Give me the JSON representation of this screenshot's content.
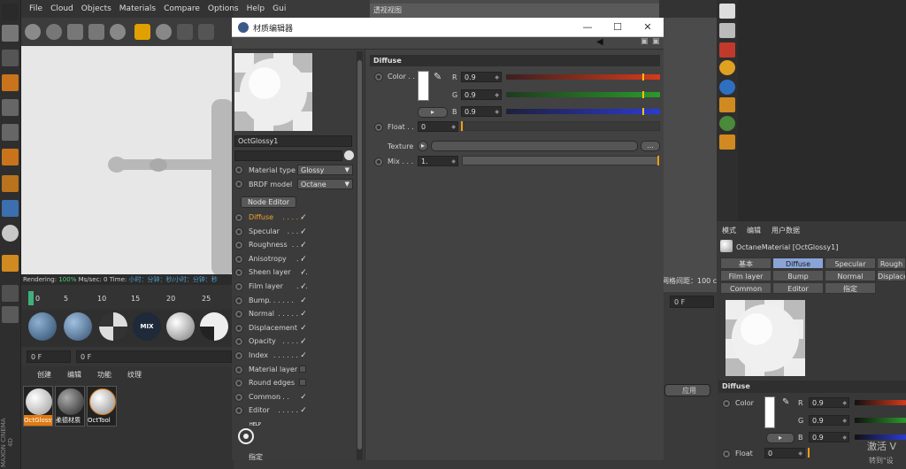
{
  "menubar": {
    "items": [
      "File",
      "Cloud",
      "Objects",
      "Materials",
      "Compare",
      "Options",
      "Help",
      "Gui"
    ]
  },
  "viewport": {
    "status_rendering_label": "Rendering:",
    "status_rendering_value": "100%",
    "status_ms_label": "Ms/sec:",
    "status_ms_value": "0",
    "status_time_label": "Time:",
    "status_time_value": "小时：分钟：秒/小时：分钟：秒"
  },
  "timeline": {
    "ticks": [
      "0",
      "5",
      "10",
      "15",
      "20",
      "25"
    ],
    "frame_field": "0 F",
    "frame_field2": "0 F"
  },
  "swatches": {
    "mix_label": "MIX"
  },
  "material_manager": {
    "menu": [
      "创建",
      "编辑",
      "功能",
      "纹理"
    ],
    "materials": [
      {
        "name": "OctGlossy",
        "selected": true
      },
      {
        "name": "柔德材质",
        "selected": false
      },
      {
        "name": "OctTool",
        "selected": false
      }
    ]
  },
  "bg_viewport": {
    "header": "透视视图",
    "grid_info": "网格间距：100 cm"
  },
  "attr_manager": {
    "menu": [
      "模式",
      "编辑",
      "用户数据"
    ],
    "title": "OctaneMaterial [OctGlossy1]",
    "tabs_row1": [
      "基本",
      "Diffuse",
      "Specular",
      "Rough"
    ],
    "tabs_row2": [
      "Film layer",
      "Bump",
      "Normal",
      "Displace"
    ],
    "tabs_row3": [
      "Common",
      "Editor",
      "指定"
    ],
    "active_tab": "Diffuse",
    "section": "Diffuse",
    "color_label": "Color",
    "r_label": "R",
    "g_label": "G",
    "b_label": "B",
    "r_value": "0.9",
    "g_value": "0.9",
    "b_value": "0.9",
    "float_label": "Float",
    "float_value": "0",
    "frame_field": "0 F",
    "apply_button": "应用"
  },
  "dialog": {
    "title": "材质编辑器",
    "material_name": "OctGlossy1",
    "material_type_label": "Material type",
    "material_type_value": "Glossy",
    "brdf_label": "BRDF model",
    "brdf_value": "Octane",
    "node_editor_button": "Node Editor",
    "channels": [
      {
        "label": "Diffuse",
        "dots": ". . . . .",
        "checked": true,
        "active": true
      },
      {
        "label": "Specular",
        "dots": ". . . .",
        "checked": true,
        "active": false
      },
      {
        "label": "Roughness",
        "dots": ". . .",
        "checked": true,
        "active": false
      },
      {
        "label": "Anisotropy",
        "dots": ". .",
        "checked": true,
        "active": false
      },
      {
        "label": "Sheen layer",
        "dots": ". .",
        "checked": true,
        "active": false
      },
      {
        "label": "Film layer",
        "dots": ". . .",
        "checked": true,
        "active": false
      },
      {
        "label": "Bump",
        "dots": ". . . . . .",
        "checked": true,
        "active": false
      },
      {
        "label": "Normal",
        "dots": ". . . . .",
        "checked": true,
        "active": false
      },
      {
        "label": "Displacement",
        "dots": "",
        "checked": true,
        "active": false
      },
      {
        "label": "Opacity",
        "dots": ". . . . .",
        "checked": true,
        "active": false
      },
      {
        "label": "Index",
        "dots": ". . . . . .",
        "checked": true,
        "active": false
      },
      {
        "label": "Material layer",
        "dots": "",
        "checked": false,
        "active": false
      },
      {
        "label": "Round edges",
        "dots": "",
        "checked": false,
        "active": false
      },
      {
        "label": "Common",
        "dots": ". . .",
        "checked": true,
        "active": false
      },
      {
        "label": "Editor",
        "dots": ". . . . .",
        "checked": true,
        "active": false
      }
    ],
    "help_label": "HELP",
    "assign_label": "指定",
    "diffuse_section": "Diffuse",
    "color_label": "Color . .",
    "r_label": "R",
    "g_label": "G",
    "b_label": "B",
    "r_value": "0.9",
    "g_value": "0.9",
    "b_value": "0.9",
    "float_label": "Float . .",
    "float_value": "0",
    "texture_label": "Texture",
    "texture_more": "...",
    "mix_label": "Mix . . .",
    "mix_value": "1."
  },
  "watermark": {
    "line1": "激活 V",
    "line2": "转到\"设"
  },
  "colors": {
    "accent_orange": "#f39c12",
    "active_channel": "#f0a030",
    "slider_red": "#d63a1a",
    "slider_green": "#2a9a2a",
    "slider_blue": "#2a3ad6",
    "tab_active": "#8aa4d8"
  },
  "brand": {
    "text": "MAXON CINEMA 4D"
  }
}
